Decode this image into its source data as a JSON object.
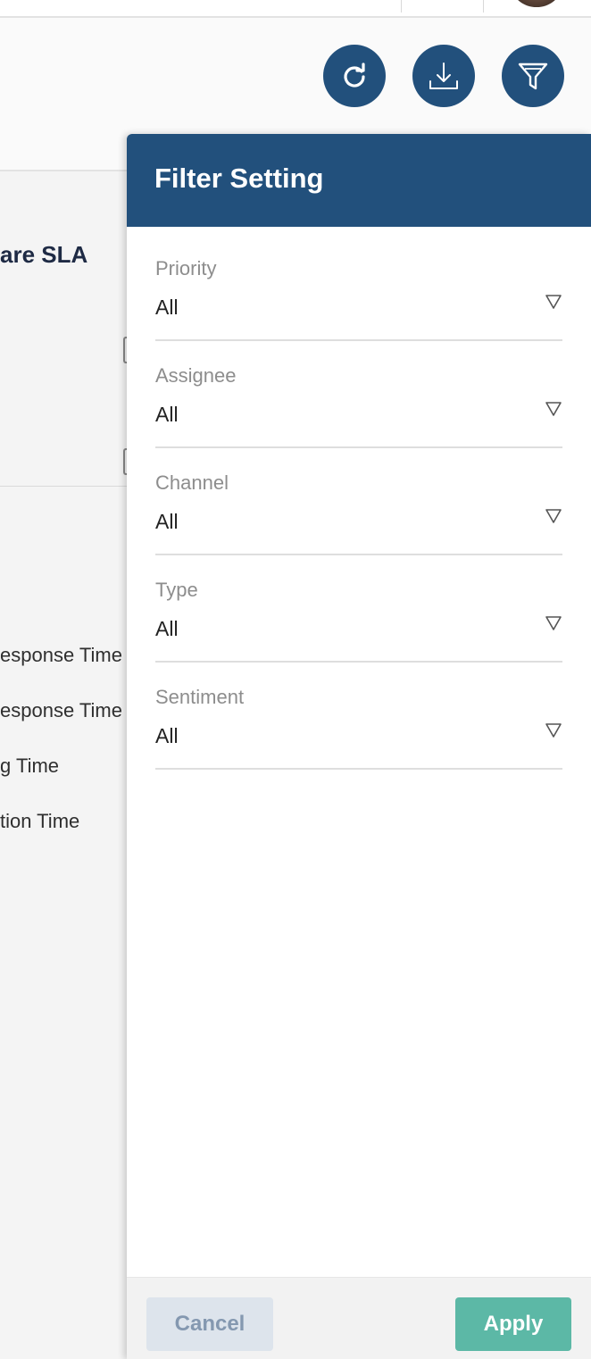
{
  "header": {
    "refresh_icon": "refresh-icon",
    "download_icon": "download-icon",
    "filter_icon": "funnel-icon",
    "accent_color": "#22507c"
  },
  "background": {
    "card_title": "are SLA",
    "items": [
      "esponse Time",
      "esponse Time",
      "g Time",
      "tion Time"
    ]
  },
  "filter_panel": {
    "title": "Filter Setting",
    "fields": [
      {
        "label": "Priority",
        "value": "All"
      },
      {
        "label": "Assignee",
        "value": "All"
      },
      {
        "label": "Channel",
        "value": "All"
      },
      {
        "label": "Type",
        "value": "All"
      },
      {
        "label": "Sentiment",
        "value": "All"
      }
    ],
    "cancel_label": "Cancel",
    "apply_label": "Apply",
    "apply_color": "#5cb8a6"
  }
}
